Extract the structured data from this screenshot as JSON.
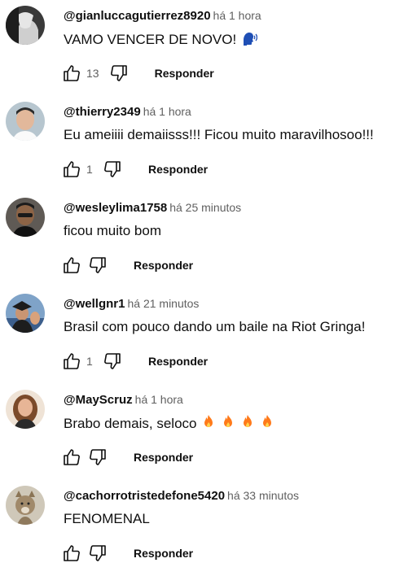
{
  "comments": [
    {
      "author": "@gianluccagutierrez8920",
      "time": "há 1 hora",
      "text": "VAMO VENCER DE NOVO!",
      "emoji": "speaking-head",
      "likes": "13",
      "reply_label": "Responder",
      "avatar": {
        "bg": "#3a3a3a",
        "fg": "#e6e6e6"
      }
    },
    {
      "author": "@thierry2349",
      "time": "há 1 hora",
      "text": "Eu ameiiii demaiisss!!! Ficou muito maravilhosoo!!!",
      "likes": "1",
      "reply_label": "Responder",
      "avatar": {
        "bg": "#b7c6cf",
        "fg": "#e2b89b"
      }
    },
    {
      "author": "@wesleylima1758",
      "time": "há 25 minutos",
      "text": "ficou muito bom",
      "likes": "",
      "reply_label": "Responder",
      "avatar": {
        "bg": "#5f5a55",
        "fg": "#8d6446"
      }
    },
    {
      "author": "@wellgnr1",
      "time": "há 21 minutos",
      "text": "Brasil com pouco dando um baile na Riot Gringa!",
      "likes": "1",
      "reply_label": "Responder",
      "avatar": {
        "bg": "#7fa3c8",
        "fg": "#1c1c1c"
      }
    },
    {
      "author": "@MayScruz",
      "time": "há 1 hora",
      "text": "Brabo demais, seloco",
      "emoji": "fire",
      "emoji_count": 4,
      "likes": "",
      "reply_label": "Responder",
      "avatar": {
        "bg": "#efe3d6",
        "fg": "#7b4a2a"
      }
    },
    {
      "author": "@cachorrotristedefone5420",
      "time": "há 33 minutos",
      "text": "FENOMENAL",
      "likes": "",
      "reply_label": "Responder",
      "avatar": {
        "bg": "#cfc8b9",
        "fg": "#a0896a"
      }
    }
  ],
  "icons": {
    "like": "thumbs-up-icon",
    "dislike": "thumbs-down-icon"
  },
  "colors": {
    "text": "#0f0f0f",
    "secondary": "#606060",
    "background": "#ffffff",
    "fire": "#ff7a1a",
    "speaking_head": "#1f4fb5"
  }
}
